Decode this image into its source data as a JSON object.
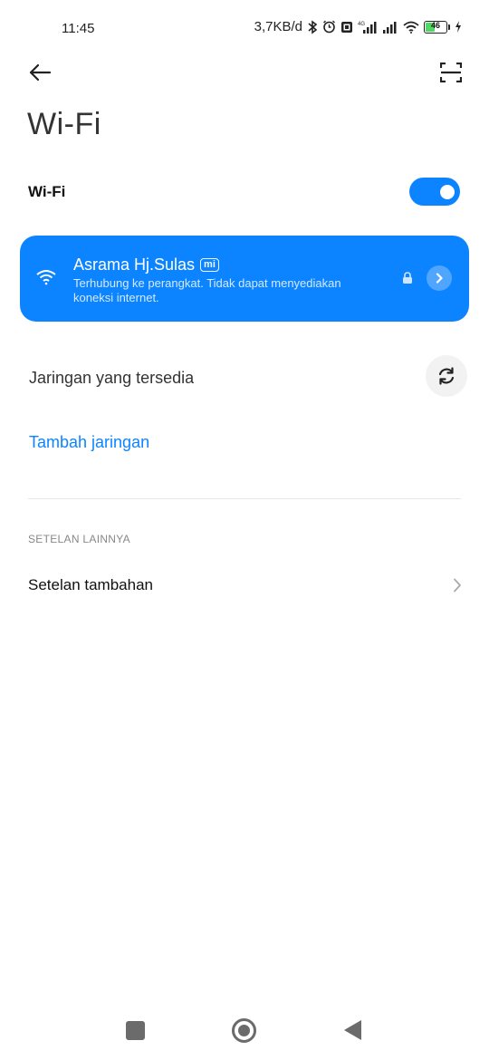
{
  "status_bar": {
    "time": "11:45",
    "net_speed": "3,7KB/d",
    "battery_level": "46",
    "icons": [
      "bluetooth-icon",
      "alarm-icon",
      "nfc-icon",
      "4g-signal-icon",
      "signal-icon",
      "wifi-icon",
      "battery-icon",
      "charging-icon"
    ]
  },
  "header": {
    "title": "Wi-Fi",
    "back_icon": "arrow-left-icon",
    "scan_icon": "scan-qr-icon"
  },
  "wifi_toggle": {
    "label": "Wi-Fi",
    "enabled": true
  },
  "connected_network": {
    "name": "Asrama Hj.Sulas",
    "badge": "mi",
    "status": "Terhubung ke perangkat. Tidak dapat menyediakan koneksi internet.",
    "secured": true
  },
  "available_networks": {
    "label": "Jaringan yang tersedia",
    "refresh_icon": "refresh-icon"
  },
  "add_network": {
    "label": "Tambah jaringan"
  },
  "other_settings": {
    "section_header": "SETELAN LAINNYA",
    "items": [
      {
        "label": "Setelan tambahan"
      }
    ]
  },
  "colors": {
    "accent": "#0d84ff",
    "background": "#ffffff",
    "nav_icon": "#6b6b6b"
  }
}
